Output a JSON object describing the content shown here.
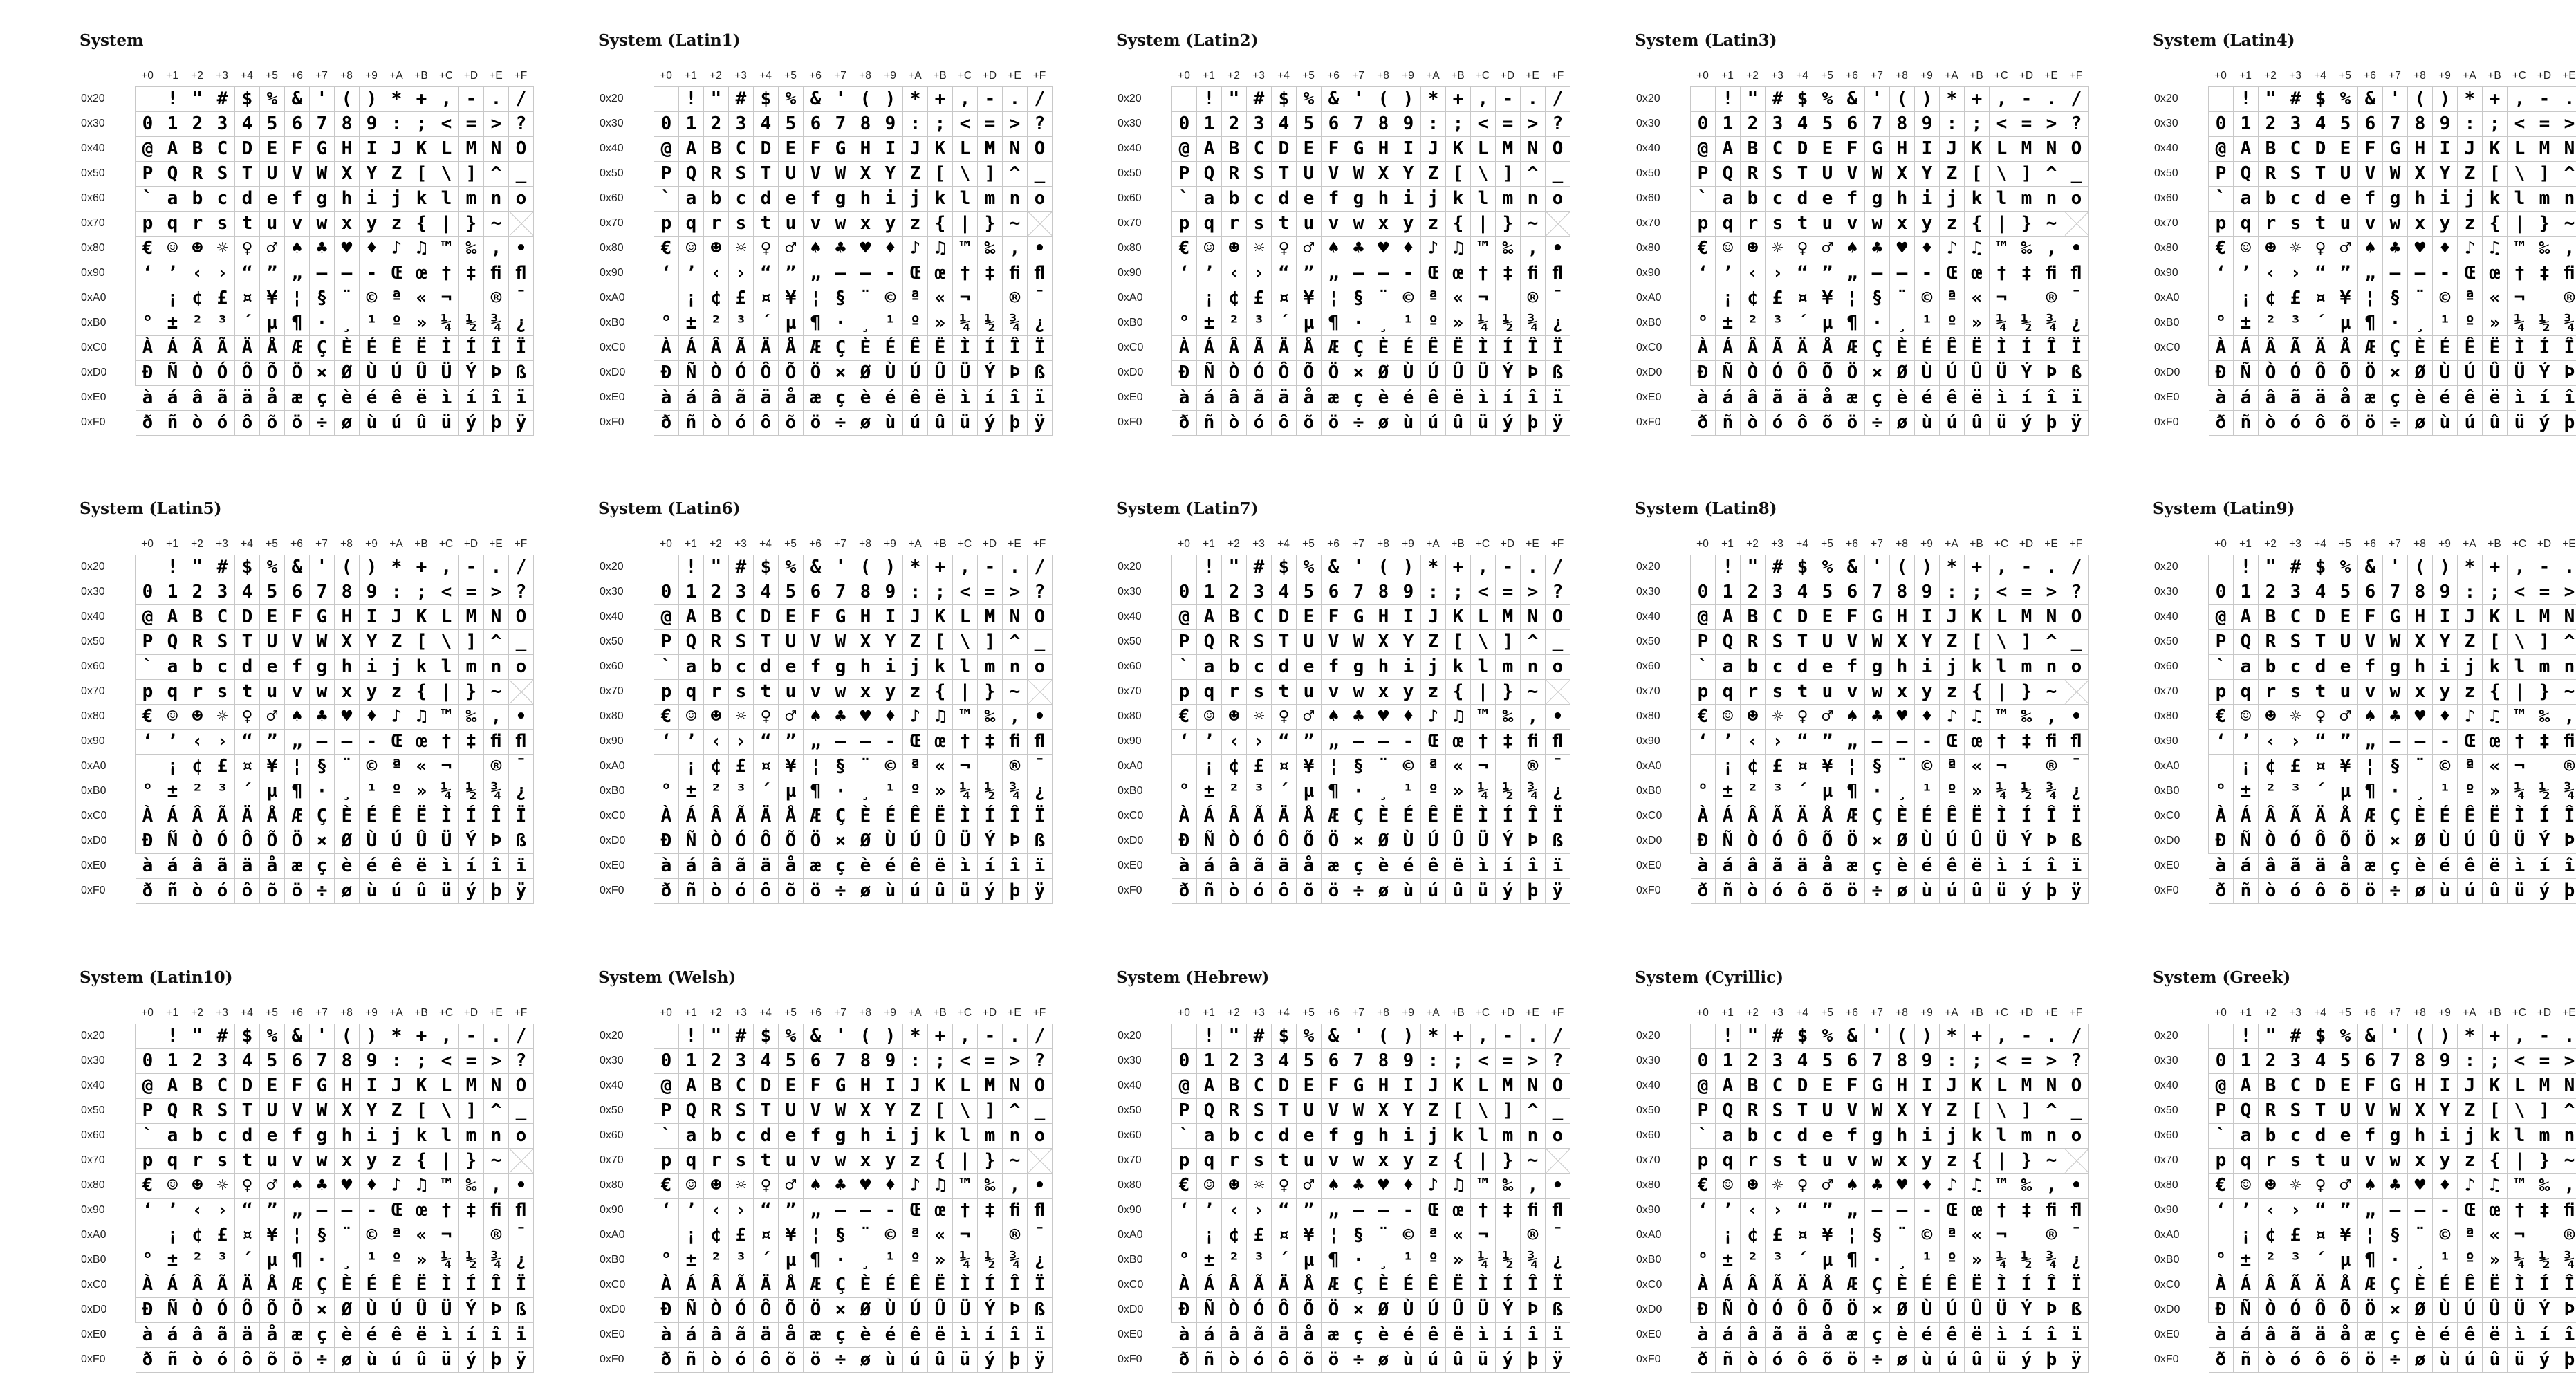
{
  "column_labels": [
    "+0",
    "+1",
    "+2",
    "+3",
    "+4",
    "+5",
    "+6",
    "+7",
    "+8",
    "+9",
    "+A",
    "+B",
    "+C",
    "+D",
    "+E",
    "+F"
  ],
  "row_labels": [
    "0x20",
    "0x30",
    "0x40",
    "0x50",
    "0x60",
    "0x70",
    "0x80",
    "0x90",
    "0xA0",
    "0xB0",
    "0xC0",
    "0xD0",
    "0xE0",
    "0xF0"
  ],
  "rows": [
    " !\"#$%&'()*+,-./",
    "0123456789:;<=>?",
    "@ABCDEFGHIJKLMNO",
    "PQRSTUVWXYZ[\\]^_",
    "`abcdefghijklmno",
    "pqrstuvwxyz{|}~ ",
    "€☺☻☼♀♂♠♣♥♦♪♫™‰‚•",
    "‘’‹›“”„–—‑Œœ†‡ﬁﬂ",
    " ¡¢£¤¥¦§¨©ª«¬­®¯",
    "°±²³´µ¶·¸¹º»¼½¾¿",
    "ÀÁÂÃÄÅÆÇÈÉÊËÌÍÎÏ",
    "ÐÑÒÓÔÕÖ×ØÙÚÛÜÝÞß",
    "àáâãäåæçèéêëìíîï",
    "ðñòóôõö÷øùúûüýþÿ"
  ],
  "panels": [
    {
      "title": "System"
    },
    {
      "title": "System (Latin1)"
    },
    {
      "title": "System (Latin2)"
    },
    {
      "title": "System (Latin3)"
    },
    {
      "title": "System (Latin4)"
    },
    {
      "title": "System (Latin5)"
    },
    {
      "title": "System (Latin6)"
    },
    {
      "title": "System (Latin7)"
    },
    {
      "title": "System (Latin8)"
    },
    {
      "title": "System (Latin9)"
    },
    {
      "title": "System (Latin10)"
    },
    {
      "title": "System (Welsh)"
    },
    {
      "title": "System (Hebrew)"
    },
    {
      "title": "System (Cyrillic)"
    },
    {
      "title": "System (Greek)"
    }
  ]
}
